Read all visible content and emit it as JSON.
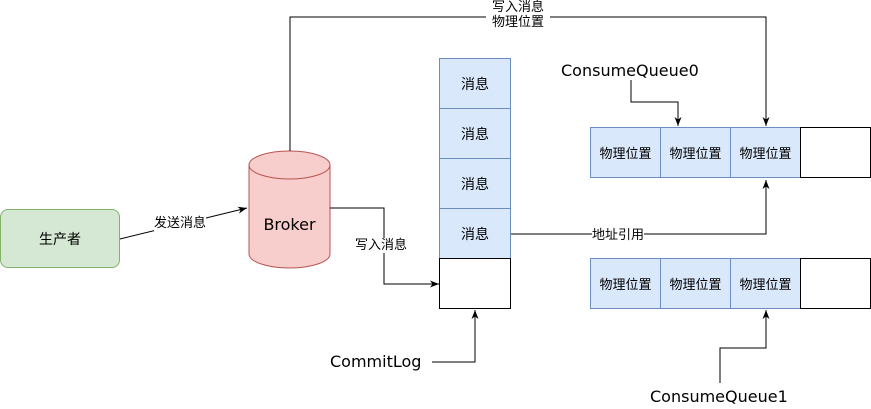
{
  "producer": {
    "label": "生产者"
  },
  "broker": {
    "label": "Broker"
  },
  "commitlog": {
    "cells": [
      "消息",
      "消息",
      "消息",
      "消息"
    ],
    "label": "CommitLog"
  },
  "queue0": {
    "label": "ConsumeQueue0",
    "cells": [
      "物理位置",
      "物理位置",
      "物理位置"
    ]
  },
  "queue1": {
    "label": "ConsumeQueue1",
    "cells": [
      "物理位置",
      "物理位置",
      "物理位置"
    ]
  },
  "edges": {
    "send": "发送消息",
    "write_commitlog": "写入消息",
    "write_queue_line1": "写入消息",
    "write_queue_line2": "物理位置",
    "address_ref": "地址引用"
  },
  "colors": {
    "producer_fill": "#d5e8d4",
    "producer_stroke": "#82b366",
    "broker_fill": "#f8cecc",
    "broker_stroke": "#b85450",
    "cell_fill": "#dae8fc",
    "cell_stroke": "#6c8ebf"
  }
}
